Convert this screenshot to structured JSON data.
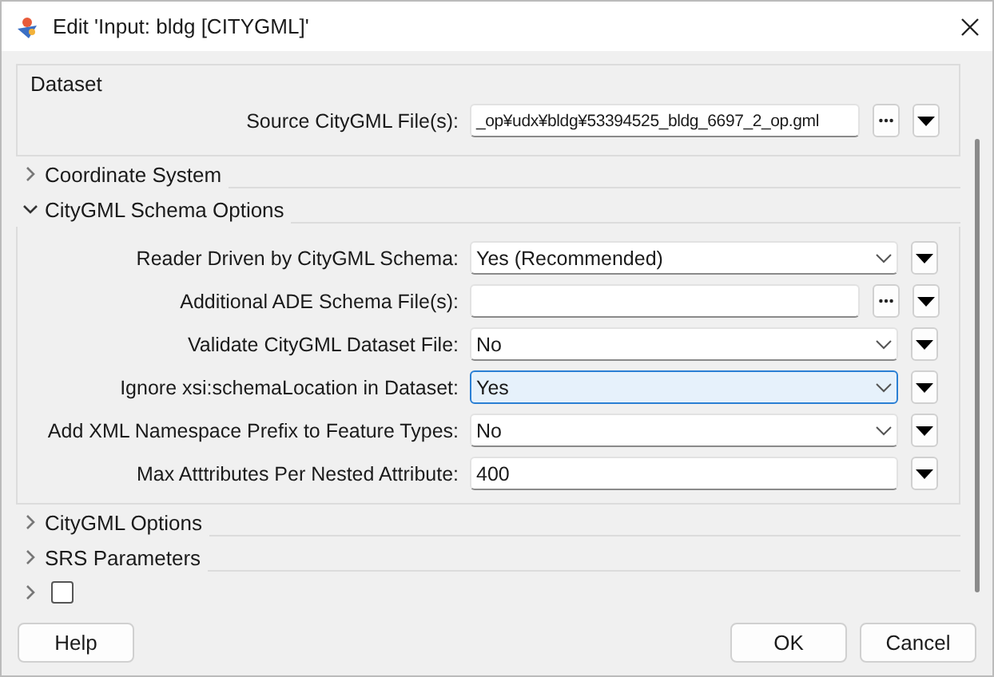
{
  "window": {
    "title": "Edit 'Input: bldg [CITYGML]'"
  },
  "sections": [
    {
      "kind": "group",
      "title": "Dataset",
      "fields": [
        {
          "kind": "file",
          "label": "Source CityGML File(s):",
          "value": "_op¥udx¥bldg¥53394525_bldg_6697_2_op.gml",
          "focused": false
        }
      ]
    },
    {
      "kind": "collapsible",
      "title": "Coordinate System",
      "expanded": false
    },
    {
      "kind": "collapsible",
      "title": "CityGML Schema Options",
      "expanded": true,
      "fields": [
        {
          "kind": "select",
          "label": "Reader Driven by CityGML Schema:",
          "value": "Yes (Recommended)",
          "focused": false
        },
        {
          "kind": "file",
          "label": "Additional ADE Schema File(s):",
          "focused": false
        },
        {
          "kind": "select",
          "label": "Validate CityGML Dataset File:",
          "value": "No",
          "focused": false
        },
        {
          "kind": "select",
          "label": "Ignore xsi:schemaLocation in Dataset:",
          "value": "Yes",
          "focused": true
        },
        {
          "kind": "select",
          "label": "Add XML Namespace Prefix to Feature Types:",
          "value": "No",
          "focused": false
        },
        {
          "kind": "text",
          "label": "Max Atttributes Per Nested Attribute:",
          "value": "400",
          "focused": false
        }
      ]
    },
    {
      "kind": "collapsible",
      "title": "CityGML Options",
      "expanded": false
    },
    {
      "kind": "collapsible",
      "title": "SRS Parameters",
      "expanded": false
    },
    {
      "kind": "checkrow",
      "expanded": false,
      "checked": false
    }
  ],
  "buttons": {
    "help": "Help",
    "ok": "OK",
    "cancel": "Cancel"
  }
}
